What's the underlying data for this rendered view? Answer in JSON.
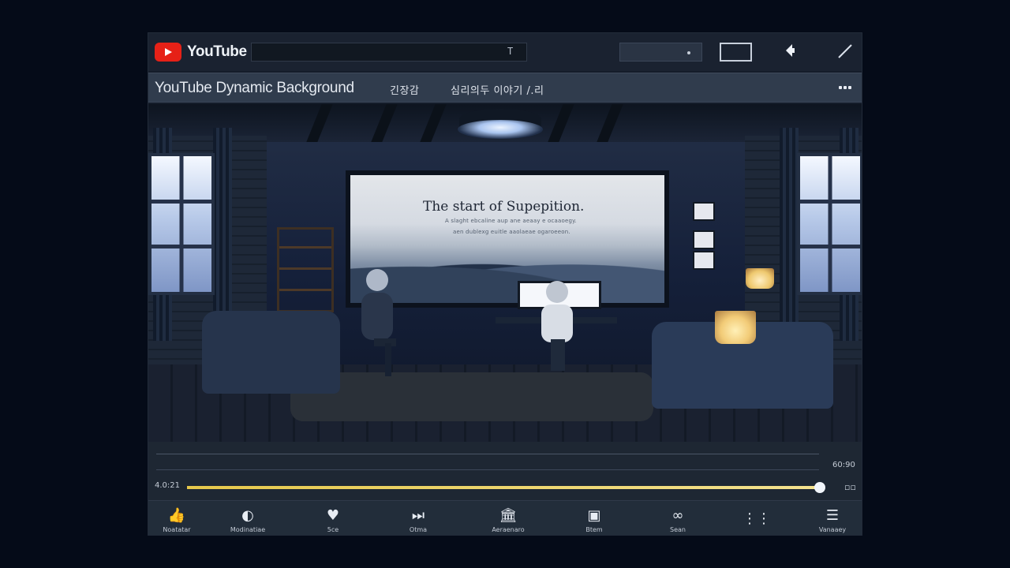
{
  "app": {
    "brand": "YouTube",
    "search": {
      "value": "",
      "placeholder": ""
    },
    "search_icon_text": "T"
  },
  "header_actions": {
    "field_dot": "•"
  },
  "video": {
    "title": "YouTube Dynamic Background",
    "subtitle": "긴장감",
    "meta": "심리의두 이야기 /.리"
  },
  "scene": {
    "screen_title": "The start of Supepition.",
    "screen_line1": "A slaght ebcaline aup ane aeaay e ocaaoegy.",
    "screen_line2": "aen dublexg euitle aaolaeae ogaroeeon."
  },
  "player": {
    "current_time": "4.0:21",
    "duration": "60:90",
    "progress_fraction": 0.995,
    "volume_icon": "▫▫",
    "buttons": [
      {
        "icon": "like-icon",
        "label": "Noatatar"
      },
      {
        "icon": "circle-split-icon",
        "label": "Modinatiae"
      },
      {
        "icon": "heart-icon",
        "label": "5ce"
      },
      {
        "icon": "next-icon",
        "label": "Otma"
      },
      {
        "icon": "library-icon",
        "label": "Aeraenaro"
      },
      {
        "icon": "screen-icon",
        "label": "Btem"
      },
      {
        "icon": "link-icon",
        "label": "Sean"
      },
      {
        "icon": "grid-icon",
        "label": ""
      },
      {
        "icon": "list-icon",
        "label": "Vanaaey"
      }
    ]
  },
  "colors": {
    "youtube_red": "#e62117",
    "progress_yellow": "#e6c84b",
    "dark_bg": "#141c29"
  }
}
